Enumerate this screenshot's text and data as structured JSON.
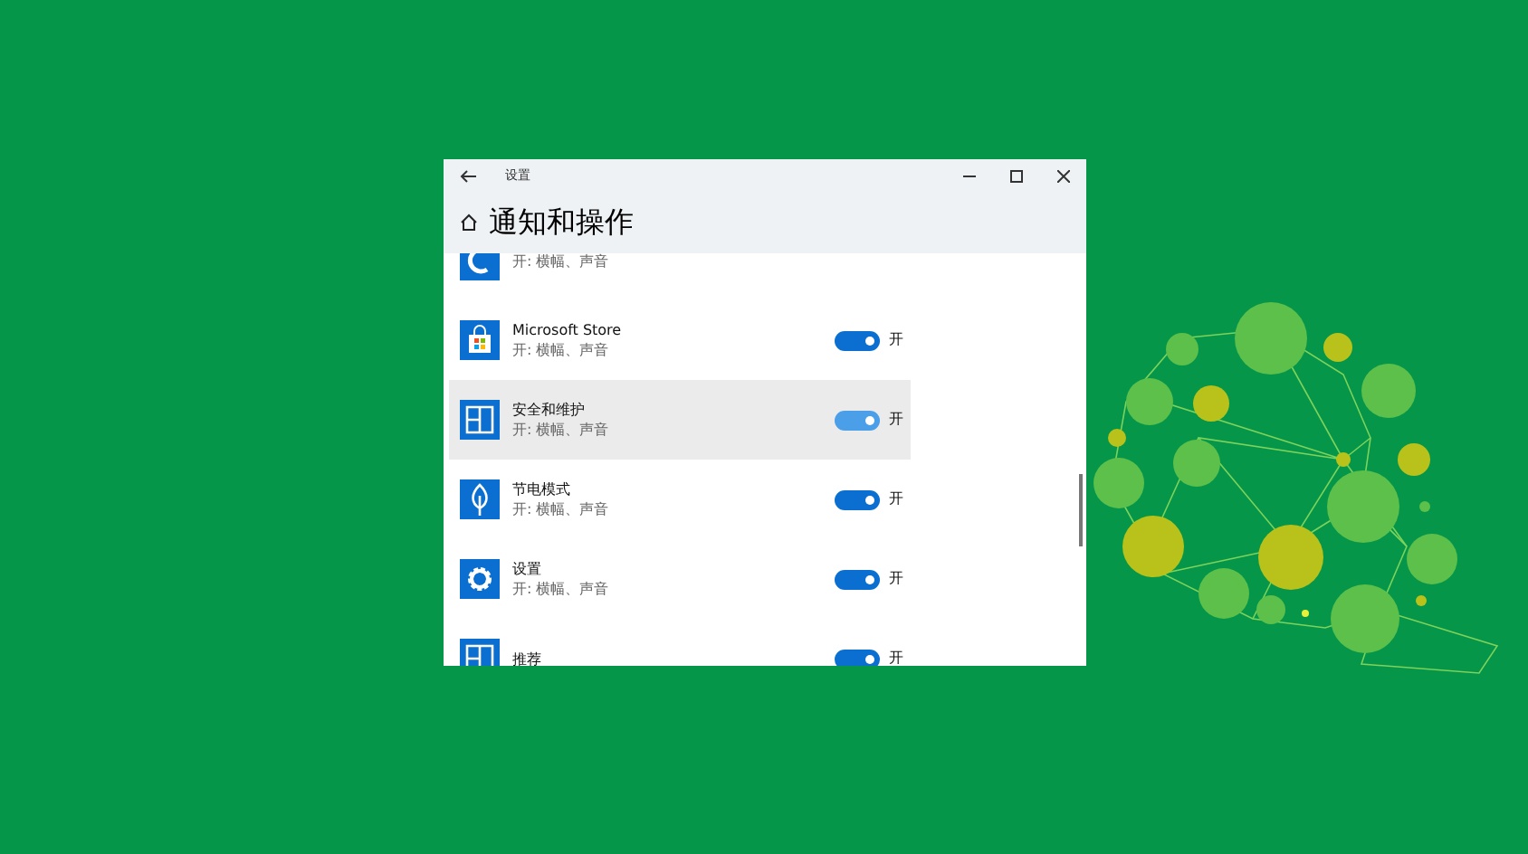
{
  "window": {
    "title": "设置",
    "page_title": "通知和操作"
  },
  "apps": [
    {
      "kind": "partial",
      "subtitle": "开: 横幅、声音"
    },
    {
      "kind": "store",
      "name": "Microsoft Store",
      "subtitle": "开: 横幅、声音",
      "on": true,
      "highlighted": false,
      "state_label": "开"
    },
    {
      "kind": "panes",
      "name": "安全和维护",
      "subtitle": "开: 横幅、声音",
      "on": true,
      "highlighted": true,
      "state_label": "开"
    },
    {
      "kind": "leaf",
      "name": "节电模式",
      "subtitle": "开: 横幅、声音",
      "on": true,
      "highlighted": false,
      "state_label": "开"
    },
    {
      "kind": "gear",
      "name": "设置",
      "subtitle": "开: 横幅、声音",
      "on": true,
      "highlighted": false,
      "state_label": "开"
    },
    {
      "kind": "panes",
      "name": "推荐",
      "on": true,
      "highlighted": false,
      "state_label": "开"
    }
  ]
}
